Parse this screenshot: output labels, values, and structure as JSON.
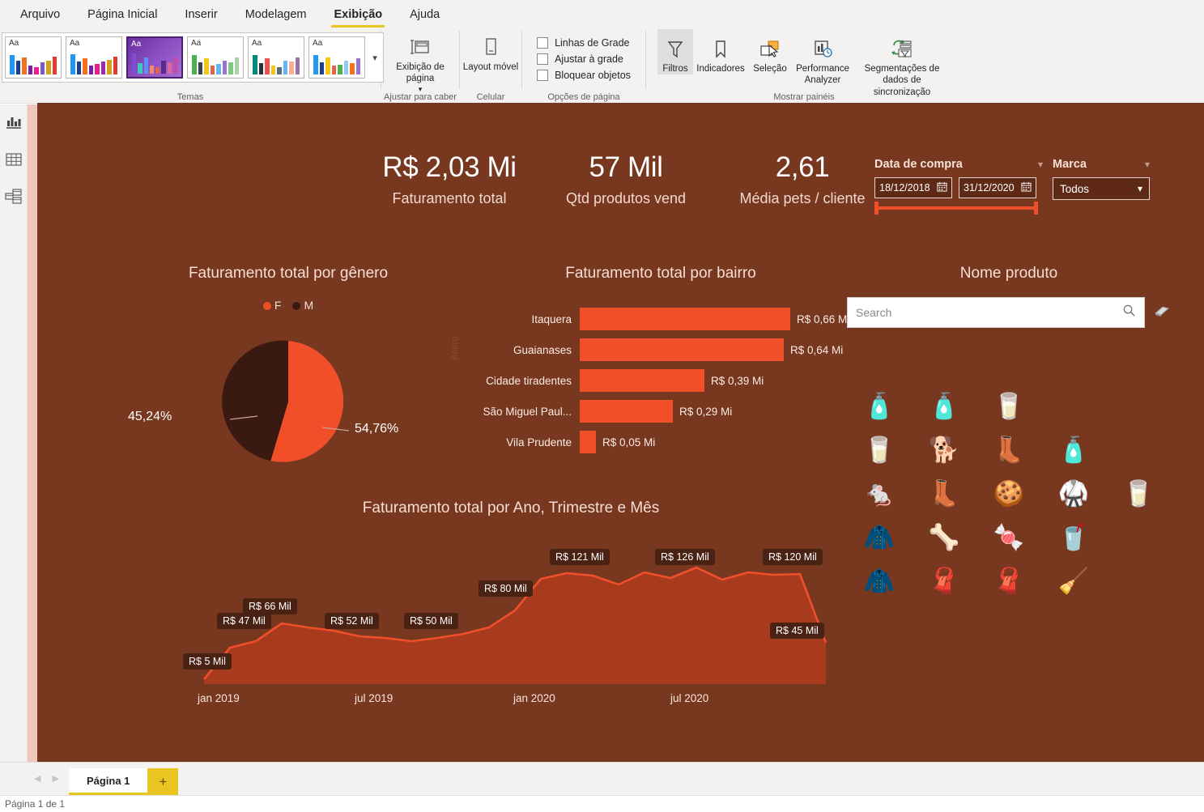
{
  "app": {
    "ribbon_tabs": [
      {
        "label": "Arquivo",
        "active": false
      },
      {
        "label": "Página Inicial",
        "active": false
      },
      {
        "label": "Inserir",
        "active": false
      },
      {
        "label": "Modelagem",
        "active": false
      },
      {
        "label": "Exibição",
        "active": true
      },
      {
        "label": "Ajuda",
        "active": false
      }
    ],
    "groups": {
      "themes": "Temas",
      "fit": "Ajustar para caber",
      "mobile": "Celular",
      "page_options": "Opções de página",
      "show_panes": "Mostrar painéis"
    },
    "theme_swatch_text": "Aa",
    "buttons": {
      "page_view": "Exibição de página",
      "mobile_layout": "Layout móvel",
      "filters": "Filtros",
      "bookmarks": "Indicadores",
      "selection": "Seleção",
      "performance_analyzer": "Performance Analyzer",
      "sync_slicers": "Segmentações de dados de sincronização"
    },
    "checkboxes": [
      {
        "label": "Linhas de Grade",
        "checked": false
      },
      {
        "label": "Ajustar à grade",
        "checked": false
      },
      {
        "label": "Bloquear objetos",
        "checked": false
      }
    ],
    "rail_icons": [
      "report-view-icon",
      "data-view-icon",
      "model-view-icon"
    ]
  },
  "colors": {
    "canvas_bg": "#78371f",
    "accent": "#f04f2a",
    "dark_slice": "#3a1a10",
    "area_fill": "#a83a1e",
    "label_pill": "#4a2214",
    "title_text": "#f6ded4",
    "ribbon_accent": "#e8c520"
  },
  "kpis": [
    {
      "value": "R$ 2,03 Mi",
      "label": "Faturamento total"
    },
    {
      "value": "57 Mil",
      "label": "Qtd produtos vend"
    },
    {
      "value": "2,61",
      "label": "Média pets / cliente"
    }
  ],
  "slicers": {
    "date": {
      "title": "Data de compra",
      "start": "18/12/2018",
      "end": "31/12/2020"
    },
    "brand": {
      "title": "Marca",
      "selected": "Todos"
    },
    "product": {
      "title": "Nome produto",
      "search_placeholder": "Search",
      "search_value": "",
      "items": [
        "dog-food-bag-blue",
        "dog-food-bag-blue",
        "pet-food-bag-beige",
        "pet-food-bag-beige",
        "dog-sitting",
        "pet-collar-pink",
        "dog-food-bag-blue",
        "toy-mouse",
        "pet-collar-orange",
        "pet-treats-ball",
        "pet-collar-red-buckle",
        "pet-food-bag-beige",
        "pet-coat-pink",
        "bone-treat",
        "treat-pouch-pink",
        "cat-food-can",
        "pet-coat-pink",
        "pet-shirt-green-hanger",
        "pet-shirt-green-hanger",
        "cat-teaser-wand"
      ]
    }
  },
  "chart_data": [
    {
      "type": "pie",
      "title": "Faturamento total por gênero",
      "legend": [
        "F",
        "M"
      ],
      "legend_position": "top",
      "categories": [
        "F",
        "M"
      ],
      "values": [
        54.76,
        45.24
      ],
      "value_labels": [
        "54,76%",
        "45,24%"
      ],
      "colors": [
        "#f04f2a",
        "#3a1a10"
      ]
    },
    {
      "type": "bar",
      "title": "Faturamento total por bairro",
      "ylabel": "Bairro",
      "xlabel": "",
      "orientation": "horizontal",
      "categories": [
        "Itaquera",
        "Guaianases",
        "Cidade tiradentes",
        "São Miguel Paul...",
        "Vila Prudente"
      ],
      "values": [
        0.66,
        0.64,
        0.39,
        0.29,
        0.05
      ],
      "value_labels": [
        "R$ 0,66 Mi",
        "R$ 0,64 Mi",
        "R$ 0,39 Mi",
        "R$ 0,29 Mi",
        "R$ 0,05 Mi"
      ],
      "xlim": [
        0,
        0.7
      ],
      "grid": false
    },
    {
      "type": "area",
      "title": "Faturamento total por Ano, Trimestre e Mês",
      "xlabel": "",
      "ylabel": "",
      "x_ticks": [
        "jan 2019",
        "jul 2019",
        "jan 2020",
        "jul 2020"
      ],
      "x": [
        "dez 2018",
        "jan 2019",
        "fev 2019",
        "mar 2019",
        "abr 2019",
        "mai 2019",
        "jun 2019",
        "jul 2019",
        "ago 2019",
        "set 2019",
        "out 2019",
        "nov 2019",
        "dez 2019",
        "jan 2020",
        "fev 2020",
        "mar 2020",
        "abr 2020",
        "mai 2020",
        "jun 2020",
        "jul 2020",
        "ago 2020",
        "set 2020",
        "out 2020",
        "nov 2020",
        "dez 2020"
      ],
      "values": [
        5,
        40,
        47,
        66,
        61,
        58,
        52,
        50,
        47,
        50,
        55,
        63,
        80,
        115,
        121,
        118,
        109,
        122,
        116,
        126,
        113,
        121,
        119,
        120,
        45
      ],
      "ylim": [
        0,
        135
      ],
      "annotations": [
        {
          "label": "R$ 5 Mil",
          "point": "dez 2018"
        },
        {
          "label": "R$ 47 Mil",
          "point": "fev 2019"
        },
        {
          "label": "R$ 66 Mil",
          "point": "mar 2019"
        },
        {
          "label": "R$ 52 Mil",
          "point": "jun 2019"
        },
        {
          "label": "R$ 50 Mil",
          "point": "jul 2019"
        },
        {
          "label": "R$ 80 Mil",
          "point": "dez 2019"
        },
        {
          "label": "R$ 121 Mil",
          "point": "fev 2020"
        },
        {
          "label": "R$ 126 Mil",
          "point": "jul 2020"
        },
        {
          "label": "R$ 120 Mil",
          "point": "nov 2020"
        },
        {
          "label": "R$ 45 Mil",
          "point": "dez 2020"
        }
      ]
    }
  ],
  "footer": {
    "page_tab": "Página 1",
    "add_page": "+",
    "status": "Página 1 de 1"
  }
}
